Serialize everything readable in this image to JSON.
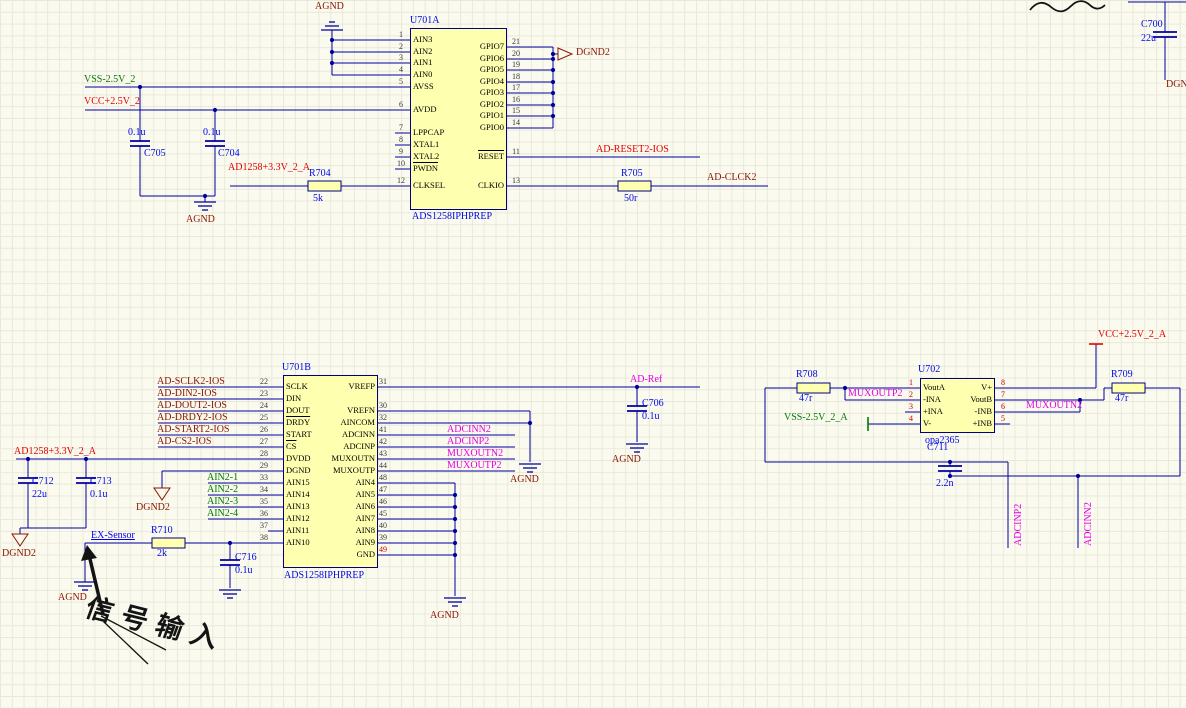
{
  "chips": {
    "u701a": {
      "designator": "U701A",
      "part": "ADS1258IPHPREP",
      "left_pins": [
        {
          "num": "1",
          "name": "AIN3"
        },
        {
          "num": "2",
          "name": "AIN2"
        },
        {
          "num": "3",
          "name": "AIN1"
        },
        {
          "num": "4",
          "name": "AIN0"
        },
        {
          "num": "5",
          "name": "AVSS"
        },
        {
          "num": "6",
          "name": "AVDD"
        },
        {
          "num": "7",
          "name": "LPPCAP"
        },
        {
          "num": "8",
          "name": "XTAL1"
        },
        {
          "num": "9",
          "name": "XTAL2"
        },
        {
          "num": "10",
          "name": "PWDN",
          "bar": true
        },
        {
          "num": "12",
          "name": "CLKSEL"
        }
      ],
      "right_pins": [
        {
          "num": "21",
          "name": "GPIO7"
        },
        {
          "num": "20",
          "name": "GPIO6"
        },
        {
          "num": "19",
          "name": "GPIO5"
        },
        {
          "num": "18",
          "name": "GPIO4"
        },
        {
          "num": "17",
          "name": "GPIO3"
        },
        {
          "num": "16",
          "name": "GPIO2"
        },
        {
          "num": "15",
          "name": "GPIO1"
        },
        {
          "num": "14",
          "name": "GPIO0"
        },
        {
          "num": "11",
          "name": "RESET",
          "bar": true
        },
        {
          "num": "13",
          "name": "CLKIO"
        }
      ]
    },
    "u701b": {
      "designator": "U701B",
      "part": "ADS1258IPHPREP",
      "left_pins": [
        {
          "num": "22",
          "name": "SCLK"
        },
        {
          "num": "23",
          "name": "DIN"
        },
        {
          "num": "24",
          "name": "DOUT"
        },
        {
          "num": "25",
          "name": "DRDY",
          "bar": true
        },
        {
          "num": "26",
          "name": "START"
        },
        {
          "num": "27",
          "name": "CS",
          "bar": true
        },
        {
          "num": "28",
          "name": "DVDD"
        },
        {
          "num": "29",
          "name": "DGND"
        },
        {
          "num": "33",
          "name": "AIN15"
        },
        {
          "num": "34",
          "name": "AIN14"
        },
        {
          "num": "35",
          "name": "AIN13"
        },
        {
          "num": "36",
          "name": "AIN12"
        },
        {
          "num": "37",
          "name": "AIN11"
        },
        {
          "num": "38",
          "name": "AIN10"
        }
      ],
      "right_pins": [
        {
          "num": "31",
          "name": "VREFP"
        },
        {
          "num": "30",
          "name": "VREFN"
        },
        {
          "num": "32",
          "name": "AINCOM"
        },
        {
          "num": "41",
          "name": "ADCINN"
        },
        {
          "num": "42",
          "name": "ADCINP"
        },
        {
          "num": "43",
          "name": "MUXOUTN"
        },
        {
          "num": "44",
          "name": "MUXOUTP"
        },
        {
          "num": "48",
          "name": "AIN4"
        },
        {
          "num": "47",
          "name": "AIN5"
        },
        {
          "num": "46",
          "name": "AIN6"
        },
        {
          "num": "45",
          "name": "AIN7"
        },
        {
          "num": "40",
          "name": "AIN8"
        },
        {
          "num": "39",
          "name": "AIN9"
        },
        {
          "num": "49",
          "name": "GND",
          "hl": true
        }
      ]
    },
    "u702": {
      "designator": "U702",
      "part": "opa2365",
      "left_pins": [
        {
          "num": "1",
          "name": "VoutA"
        },
        {
          "num": "2",
          "name": "-INA"
        },
        {
          "num": "3",
          "name": "+INA"
        },
        {
          "num": "4",
          "name": "V-"
        }
      ],
      "right_pins": [
        {
          "num": "8",
          "name": "V+"
        },
        {
          "num": "7",
          "name": "VoutB"
        },
        {
          "num": "6",
          "name": "-INB"
        },
        {
          "num": "5",
          "name": "+INB"
        }
      ]
    }
  },
  "resistors": {
    "r704": {
      "designator": "R704",
      "value": "5k"
    },
    "r705": {
      "designator": "R705",
      "value": "50r"
    },
    "r708": {
      "designator": "R708",
      "value": "47r"
    },
    "r709": {
      "designator": "R709",
      "value": "47r"
    },
    "r710": {
      "designator": "R710",
      "value": "2k"
    }
  },
  "capacitors": {
    "c700": {
      "designator": "C700",
      "value": "22u"
    },
    "c704": {
      "designator": "C704",
      "value": "0.1u"
    },
    "c705": {
      "designator": "C705",
      "value": "0.1u"
    },
    "c706": {
      "designator": "C706",
      "value": "0.1u"
    },
    "c711": {
      "designator": "C711",
      "value": "2.2n"
    },
    "c712": {
      "designator": "C712",
      "value": "22u"
    },
    "c713": {
      "designator": "C713",
      "value": "0.1u"
    },
    "c716": {
      "designator": "C716",
      "value": "0.1u"
    }
  },
  "nets": {
    "agnd": "AGND",
    "dgnd2": "DGND2",
    "vss_2v5_2": "VSS-2.5V_2",
    "vcc_2v5_2": "VCC+2.5V_2",
    "vss_2v5_2_a": "VSS-2.5V_2_A",
    "vcc_2v5_2_a": "VCC+2.5V_2_A",
    "ad1258_3v3_2_a": "AD1258+3.3V_2_A",
    "ad_reset2_ios": "AD-RESET2-IOS",
    "ad_clck2": "AD-CLCK2",
    "ad_sclk2_ios": "AD-SCLK2-IOS",
    "ad_din2_ios": "AD-DIN2-IOS",
    "ad_dout2_ios": "AD-DOUT2-IOS",
    "ad_drdy2_ios": "AD-DRDY2-IOS",
    "ad_start2_ios": "AD-START2-IOS",
    "ad_cs2_ios": "AD-CS2-IOS",
    "ad_ref": "AD-Ref",
    "adcinn2": "ADCINN2",
    "adcinp2": "ADCINP2",
    "muxoutn2": "MUXOUTN2",
    "muxoutp2": "MUXOUTP2",
    "ain2_1": "AIN2-1",
    "ain2_2": "AIN2-2",
    "ain2_3": "AIN2-3",
    "ain2_4": "AIN2-4",
    "ex_sensor": "EX-Sensor",
    "dgnd_clipped": "DGN"
  },
  "annotation": {
    "text": "信号输入"
  },
  "colors": {
    "wire": "#0000a0",
    "body_fill": "#ffffb0",
    "body_border": "#000080",
    "net_dark_red": "#8b1500",
    "net_red": "#e60000",
    "net_green": "#007a00",
    "net_magenta": "#e800e8",
    "designator_blue": "#0008e8",
    "ink": "#141414"
  }
}
